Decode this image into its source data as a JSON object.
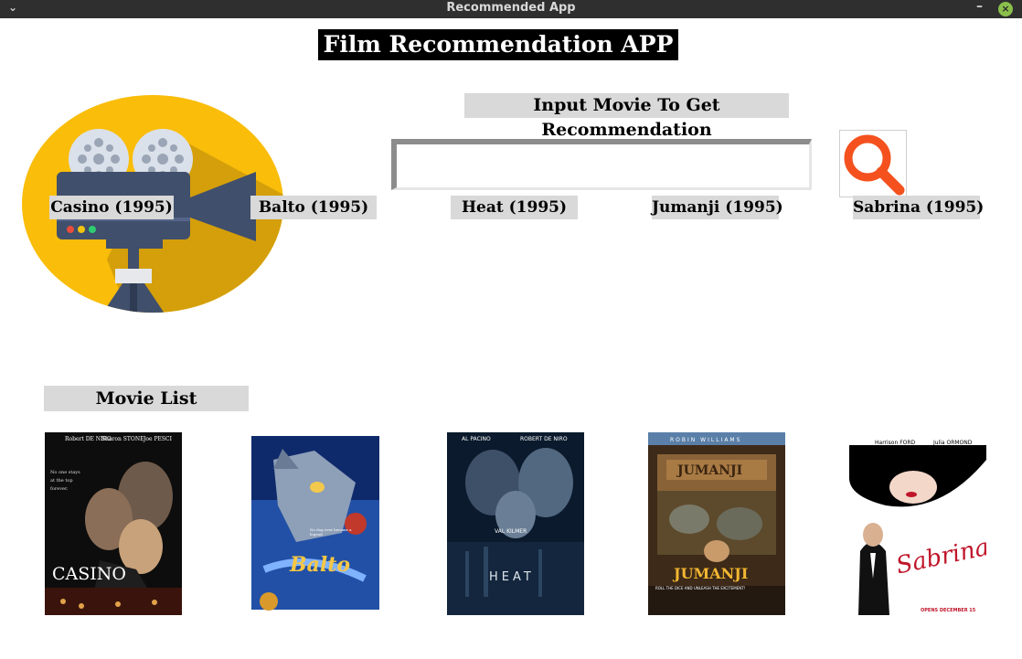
{
  "window": {
    "title": "Recommended App"
  },
  "header": {
    "title": "Film Recommendation APP"
  },
  "search": {
    "prompt": "Input Movie To Get Recommendation",
    "value": "",
    "button_icon": "search-icon"
  },
  "logo": {
    "icon": "movie-camera-icon",
    "colors": {
      "circle": "#f9bd0a",
      "body": "#404f6b"
    }
  },
  "movie_list": {
    "heading": "Movie List",
    "movies": [
      {
        "title": "Casino (1995)",
        "poster": {
          "top_credits": [
            "Robert DE NIRO",
            "Sharon STONE",
            "Joe PESCI"
          ],
          "tagline": "No one stays at the top forever.",
          "name": "CASINO"
        }
      },
      {
        "title": "Balto (1995)",
        "poster": {
          "tagline": "No dog ever became a legend",
          "name": "Balto"
        }
      },
      {
        "title": "Heat (1995)",
        "poster": {
          "top_credits": [
            "AL PACINO",
            "ROBERT DE NIRO"
          ],
          "credit": "VAL KILMER",
          "name": "HEAT"
        }
      },
      {
        "title": "Jumanji (1995)",
        "poster": {
          "top_credits": [
            "ROBIN WILLIAMS"
          ],
          "name": "JUMANJI",
          "tagline": "ROLL THE DICE AND UNLEASH THE EXCITEMENT!"
        }
      },
      {
        "title": "Sabrina (1995)",
        "poster": {
          "top_credits": [
            "Harrison FORD",
            "Julia ORMOND"
          ],
          "name": "Sabrina",
          "tagline": "OPENS DECEMBER 15"
        }
      }
    ]
  }
}
